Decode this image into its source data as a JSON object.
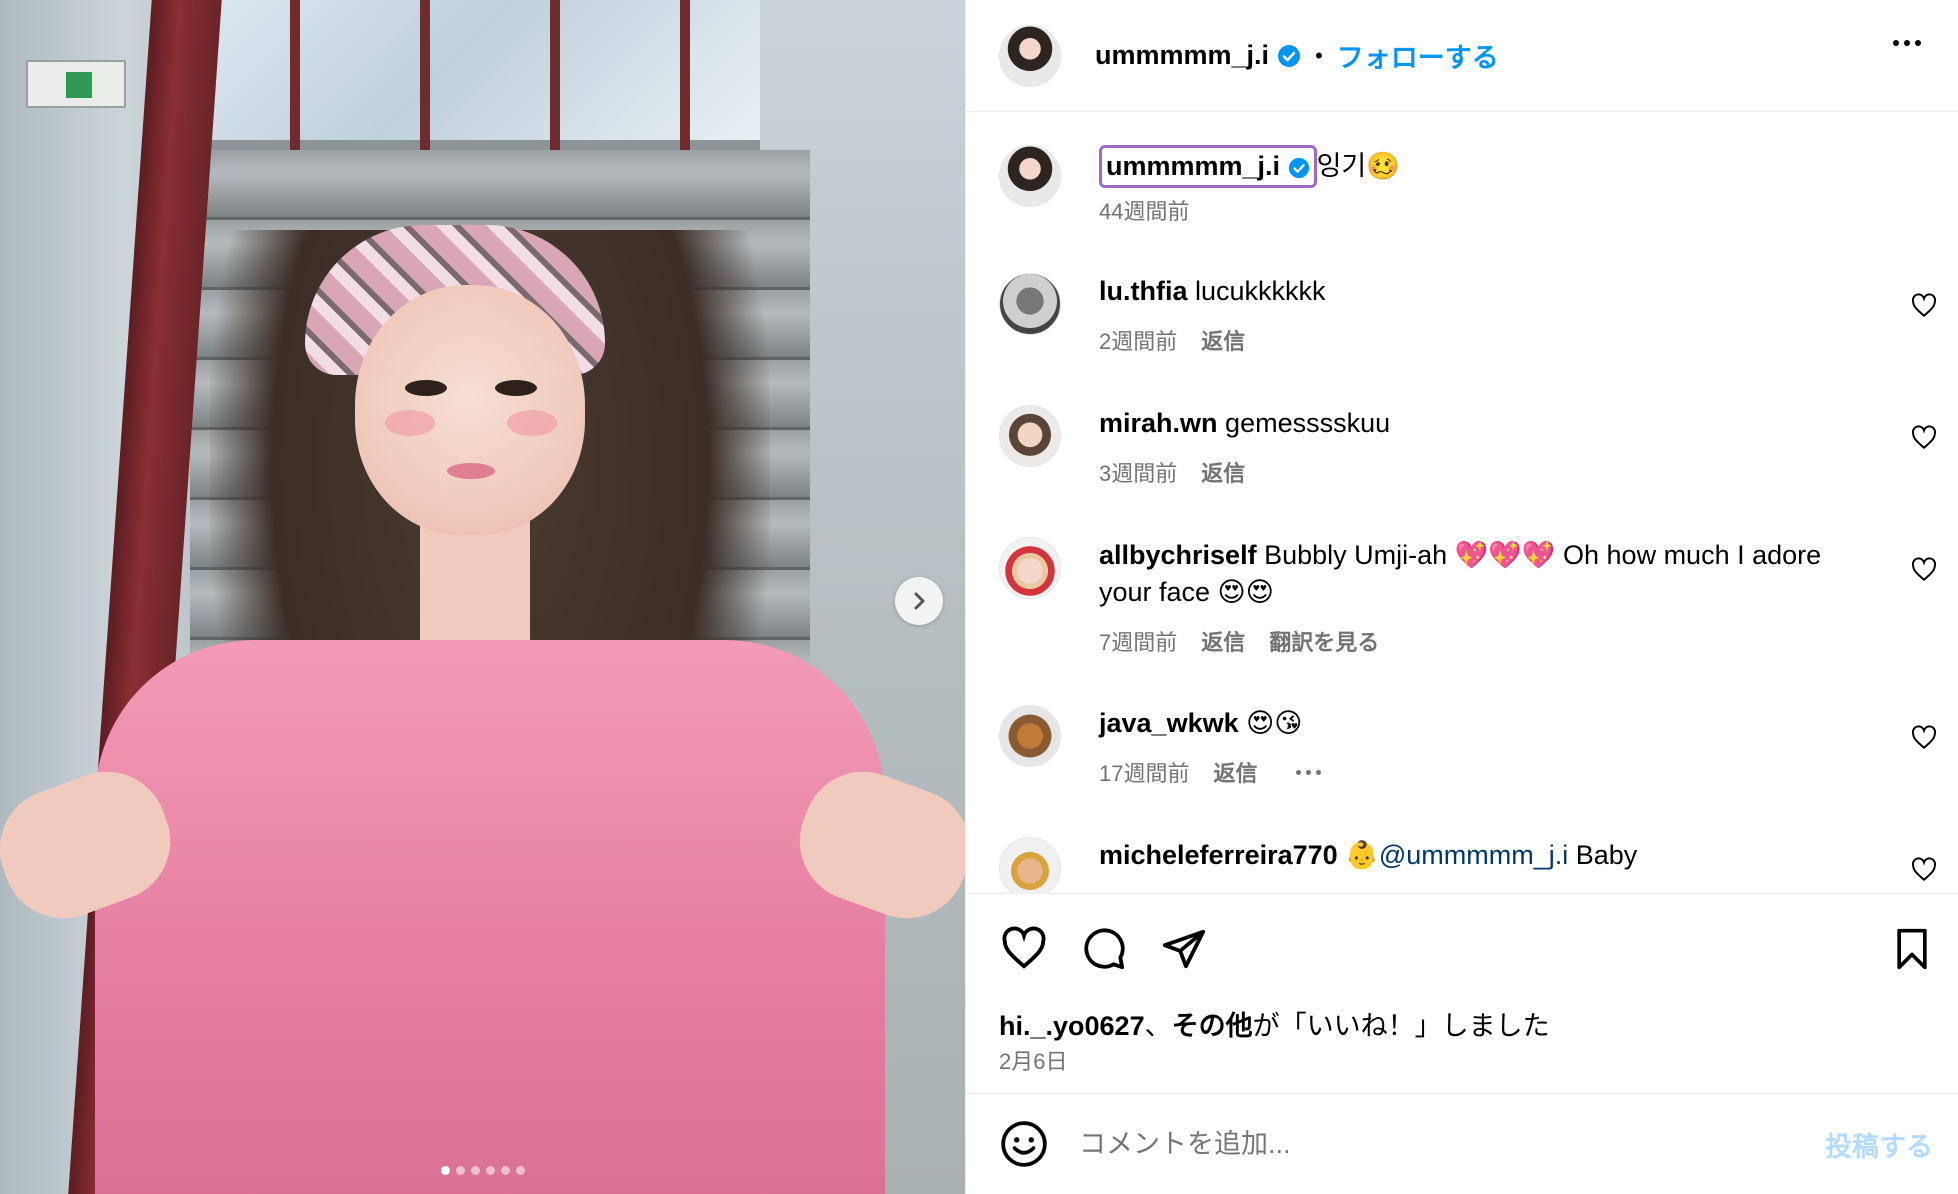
{
  "post": {
    "username": "ummmmm_j.i",
    "follow_label": "フォローする",
    "bullet": "•",
    "carousel": {
      "slide_count": 6,
      "active_index": 0
    }
  },
  "caption": {
    "username": "ummmmm_j.i",
    "text": "잉기🥴",
    "time": "44週間前"
  },
  "comments": [
    {
      "username": "lu.thfia",
      "text": "lucukkkkkk",
      "time": "2週間前",
      "reply": "返信"
    },
    {
      "username": "mirah.wn",
      "text": "gemesssskuu",
      "time": "3週間前",
      "reply": "返信"
    },
    {
      "username": "allbychriself",
      "text": "Bubbly Umji-ah 💖💖💖 Oh how much I adore your face 😍😍",
      "time": "7週間前",
      "reply": "返信",
      "translate": "翻訳を見る"
    },
    {
      "username": "java_wkwk",
      "text": "😍😘",
      "time": "17週間前",
      "reply": "返信"
    },
    {
      "username": "micheleferreira770",
      "emoji": "👶",
      "mention": "@ummmmm_j.i",
      "text": "Baby"
    }
  ],
  "likes": {
    "user": "hi._.yo0627",
    "separator": "、",
    "others": "その他",
    "suffix": "が「いいね！」しました"
  },
  "date": "2月6日",
  "composer": {
    "placeholder": "コメントを追加...",
    "post_label": "投稿する"
  },
  "colors": {
    "accent": "#0095f6",
    "mention": "#00376b",
    "muted": "#737373",
    "highlight_border": "#a169c6"
  }
}
